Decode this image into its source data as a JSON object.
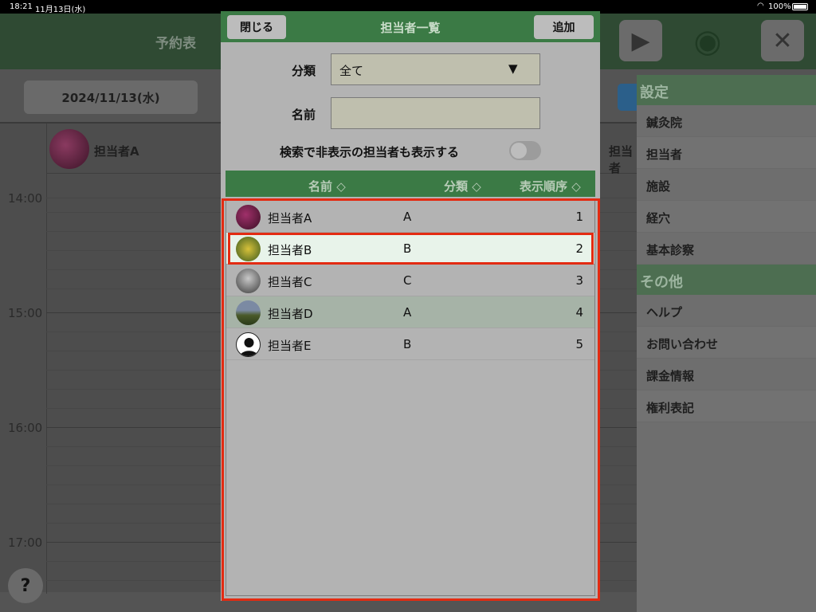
{
  "status_bar": {
    "time": "18:21",
    "date": "11月13日(水)",
    "battery": "100%"
  },
  "app": {
    "title": "予約表",
    "date_button": "2024/11/13(水)",
    "staff_columns": [
      "担当者A",
      "担当者"
    ],
    "time_labels": [
      "14:00",
      "15:00",
      "16:00",
      "17:00"
    ],
    "help": "?"
  },
  "side_menu": {
    "settings_header": "設定",
    "settings_items": [
      "鍼灸院",
      "担当者",
      "施設",
      "経穴",
      "基本診察"
    ],
    "other_header": "その他",
    "other_items": [
      "ヘルプ",
      "お問い合わせ",
      "課金情報",
      "権利表記"
    ]
  },
  "modal": {
    "title": "担当者一覧",
    "close_label": "閉じる",
    "add_label": "追加",
    "category_label": "分類",
    "category_value": "全て",
    "name_label": "名前",
    "name_value": "",
    "show_hidden_label": "検索で非表示の担当者も表示する",
    "show_hidden_on": false,
    "columns": {
      "name": "名前 ◇",
      "category": "分類 ◇",
      "order": "表示順序 ◇"
    },
    "rows": [
      {
        "name": "担当者A",
        "category": "A",
        "order": "1"
      },
      {
        "name": "担当者B",
        "category": "B",
        "order": "2"
      },
      {
        "name": "担当者C",
        "category": "C",
        "order": "3"
      },
      {
        "name": "担当者D",
        "category": "A",
        "order": "4"
      },
      {
        "name": "担当者E",
        "category": "B",
        "order": "5"
      }
    ]
  },
  "colors": {
    "accent_green": "#3b7a45",
    "highlight": "#e32b12"
  }
}
